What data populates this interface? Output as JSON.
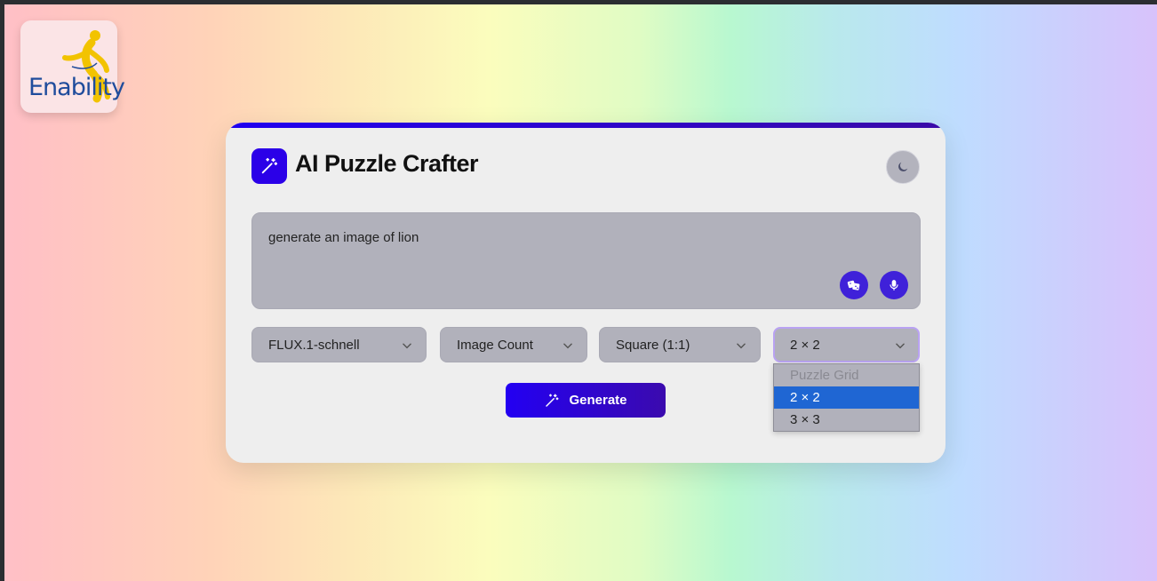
{
  "logo": {
    "text": "Enability"
  },
  "app": {
    "title": "AI Puzzle Crafter"
  },
  "prompt": {
    "value": "generate an image of lion"
  },
  "controls": {
    "model": "FLUX.1-schnell",
    "image_count": "Image Count",
    "aspect": "Square (1:1)",
    "grid": "2 × 2"
  },
  "grid_dropdown": {
    "options": [
      {
        "label": "Puzzle Grid",
        "state": "disabled"
      },
      {
        "label": "2 × 2",
        "state": "selected"
      },
      {
        "label": "3 × 3",
        "state": "normal"
      }
    ]
  },
  "generate_button": {
    "label": "Generate"
  },
  "icons": {
    "title": "magic-wand-icon",
    "theme": "moon-icon",
    "random": "dice-icon",
    "voice": "microphone-icon",
    "generate": "magic-wand-icon"
  },
  "colors": {
    "accent": "#2b00e8",
    "selected_option": "#1f66d3"
  }
}
